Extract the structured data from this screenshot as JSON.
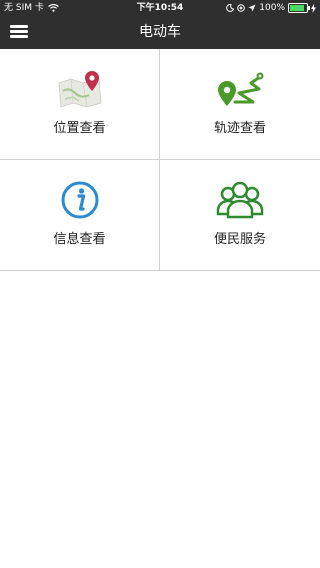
{
  "status_bar": {
    "carrier": "无 SIM 卡",
    "time": "下午10:54",
    "battery": "100%"
  },
  "header": {
    "title": "电动车",
    "menu_icon": "hamburger-menu-icon"
  },
  "menu_items": [
    {
      "label": "位置查看",
      "icon": "map-location-icon"
    },
    {
      "label": "轨迹查看",
      "icon": "track-route-icon"
    },
    {
      "label": "信息查看",
      "icon": "info-icon"
    },
    {
      "label": "便民服务",
      "icon": "people-group-icon"
    }
  ],
  "colors": {
    "header_bg": "#2f2f2f",
    "accent_green": "#4a9a2a",
    "info_blue": "#2a8bd0",
    "pin_red": "#c0304a"
  }
}
